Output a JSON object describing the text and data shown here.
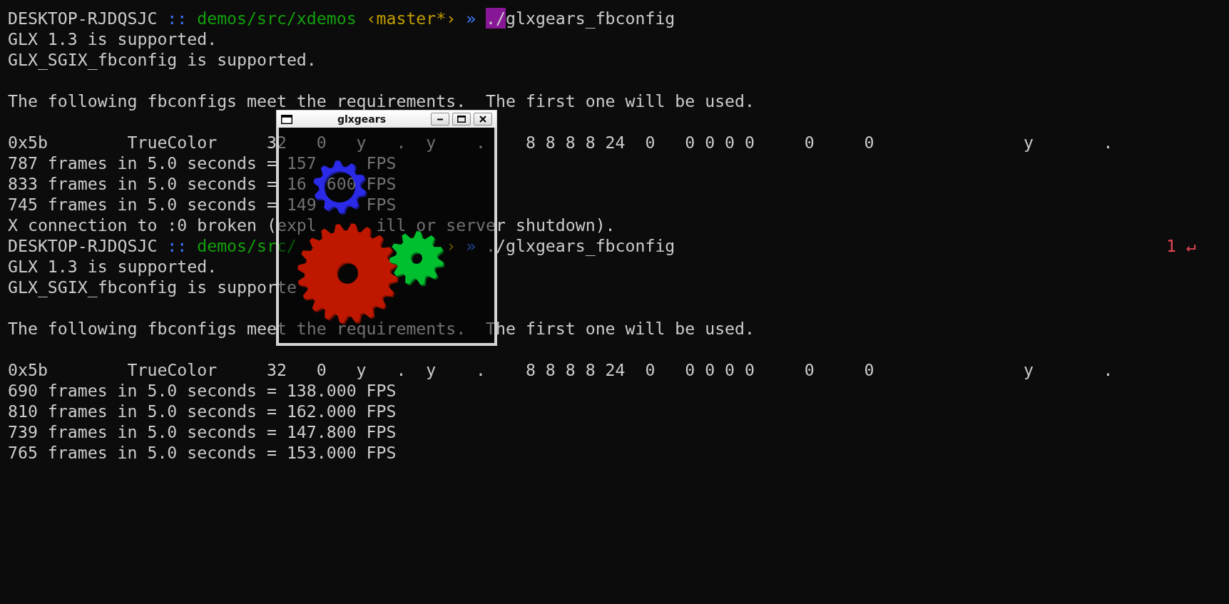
{
  "terminal": {
    "lines": [
      {
        "kind": "text",
        "segments": [
          {
            "kind": "host",
            "text": "DESKTOP-RJDQSJC"
          },
          {
            "kind": "separator",
            "text": "::"
          },
          {
            "kind": "path",
            "text": "demos/src/xdemos"
          },
          {
            "kind": "branch",
            "text": "‹master*›"
          },
          {
            "kind": "arrow",
            "text": "»"
          },
          {
            "kind": "selection",
            "text": "./"
          },
          {
            "kind": "command",
            "text": "glxgears_fbconfig"
          }
        ]
      },
      {
        "kind": "text",
        "segments": [
          {
            "kind": "output",
            "text": "GLX 1.3 is supported."
          }
        ]
      },
      {
        "kind": "text",
        "segments": [
          {
            "kind": "output",
            "text": "GLX_SGIX_fbconfig is supported."
          }
        ]
      },
      {
        "kind": "blank"
      },
      {
        "kind": "text",
        "segments": [
          {
            "kind": "output",
            "text": "The following fbconfigs meet the requirements.  The first one will be used."
          }
        ]
      },
      {
        "kind": "blank"
      },
      {
        "kind": "text",
        "segments": [
          {
            "kind": "output",
            "text": "0x5b        TrueColor     3"
          },
          {
            "kind": "output",
            "text": "2   0   y   .  y    .    8 8 8 8 24  0   0 0 0 0     0     0               y       ."
          }
        ]
      },
      {
        "kind": "text",
        "segments": [
          {
            "kind": "output",
            "text": "787 frames in 5.0 seconds = 157"
          },
          {
            "kind": "output",
            "text": "FPS"
          }
        ]
      },
      {
        "kind": "text",
        "segments": [
          {
            "kind": "output",
            "text": "833 frames in 5.0 seconds = 16"
          },
          {
            "kind": "output",
            "text": "600 FPS"
          }
        ]
      },
      {
        "kind": "text",
        "segments": [
          {
            "kind": "output",
            "text": "745 frames in 5.0 seconds = 149"
          },
          {
            "kind": "output",
            "text": "FPS"
          }
        ]
      },
      {
        "kind": "text",
        "segments": [
          {
            "kind": "output",
            "text": "X connection to :0 broken (expl"
          },
          {
            "kind": "output",
            "text": "ill"
          },
          {
            "kind": "output",
            "text": "or server shutdown)."
          }
        ]
      },
      {
        "kind": "text",
        "segments": [
          {
            "kind": "host",
            "text": "DESKTOP-RJDQSJC"
          },
          {
            "kind": "separator",
            "text": "::"
          },
          {
            "kind": "path",
            "text": "demos/src/"
          },
          {
            "kind": "branch",
            "text": "›"
          },
          {
            "kind": "arrow",
            "text": "»"
          },
          {
            "kind": "command",
            "text": "./glxgears_fbconfig"
          },
          {
            "kind": "status",
            "text": "1 ↵"
          }
        ]
      },
      {
        "kind": "text",
        "segments": [
          {
            "kind": "output",
            "text": "GLX 1.3 is supported."
          }
        ]
      },
      {
        "kind": "text",
        "segments": [
          {
            "kind": "output",
            "text": "GLX_SGIX_fbconfig is supporte"
          }
        ]
      },
      {
        "kind": "blank"
      },
      {
        "kind": "text",
        "segments": [
          {
            "kind": "output",
            "text": "The following fbconfigs meet the requirements.  The first one will be used."
          }
        ]
      },
      {
        "kind": "blank"
      },
      {
        "kind": "text",
        "segments": [
          {
            "kind": "output",
            "text": "0x5b        TrueColor     32   0   y   .  y    .    8 8 8 8 24  0   0 0 0 0     0     0               y       ."
          }
        ]
      },
      {
        "kind": "text",
        "segments": [
          {
            "kind": "output",
            "text": "690 frames in 5.0 seconds = 138.000 FPS"
          }
        ]
      },
      {
        "kind": "text",
        "segments": [
          {
            "kind": "output",
            "text": "810 frames in 5.0 seconds = 162.000 FPS"
          }
        ]
      },
      {
        "kind": "text",
        "segments": [
          {
            "kind": "output",
            "text": "739 frames in 5.0 seconds = 147.800 FPS"
          }
        ]
      },
      {
        "kind": "text",
        "segments": [
          {
            "kind": "output",
            "text": "765 frames in 5.0 seconds = 153.000 FPS"
          }
        ]
      }
    ]
  },
  "gears_window": {
    "title": "glxgears"
  }
}
